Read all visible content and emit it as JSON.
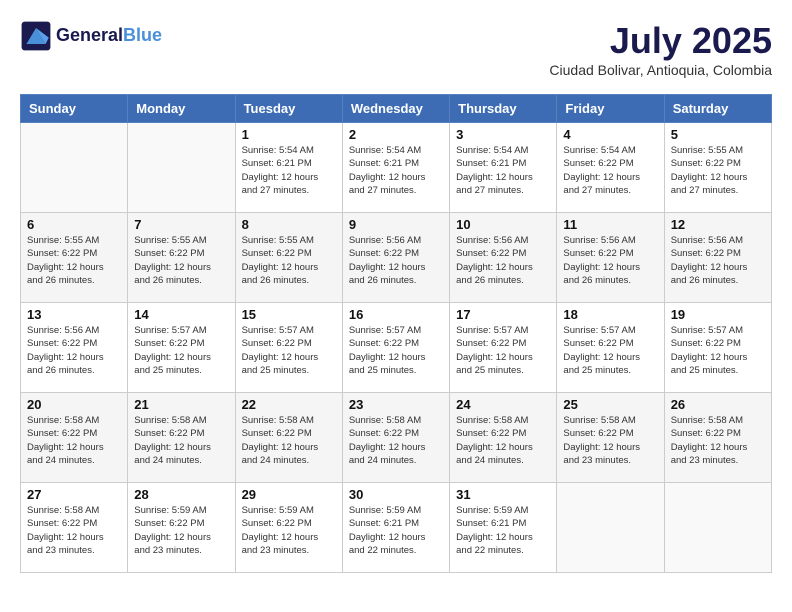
{
  "logo": {
    "line1": "General",
    "line2": "Blue"
  },
  "title": "July 2025",
  "location": "Ciudad Bolivar, Antioquia, Colombia",
  "weekdays": [
    "Sunday",
    "Monday",
    "Tuesday",
    "Wednesday",
    "Thursday",
    "Friday",
    "Saturday"
  ],
  "weeks": [
    [
      {
        "day": "",
        "info": ""
      },
      {
        "day": "",
        "info": ""
      },
      {
        "day": "1",
        "info": "Sunrise: 5:54 AM\nSunset: 6:21 PM\nDaylight: 12 hours and 27 minutes."
      },
      {
        "day": "2",
        "info": "Sunrise: 5:54 AM\nSunset: 6:21 PM\nDaylight: 12 hours and 27 minutes."
      },
      {
        "day": "3",
        "info": "Sunrise: 5:54 AM\nSunset: 6:21 PM\nDaylight: 12 hours and 27 minutes."
      },
      {
        "day": "4",
        "info": "Sunrise: 5:54 AM\nSunset: 6:22 PM\nDaylight: 12 hours and 27 minutes."
      },
      {
        "day": "5",
        "info": "Sunrise: 5:55 AM\nSunset: 6:22 PM\nDaylight: 12 hours and 27 minutes."
      }
    ],
    [
      {
        "day": "6",
        "info": "Sunrise: 5:55 AM\nSunset: 6:22 PM\nDaylight: 12 hours and 26 minutes."
      },
      {
        "day": "7",
        "info": "Sunrise: 5:55 AM\nSunset: 6:22 PM\nDaylight: 12 hours and 26 minutes."
      },
      {
        "day": "8",
        "info": "Sunrise: 5:55 AM\nSunset: 6:22 PM\nDaylight: 12 hours and 26 minutes."
      },
      {
        "day": "9",
        "info": "Sunrise: 5:56 AM\nSunset: 6:22 PM\nDaylight: 12 hours and 26 minutes."
      },
      {
        "day": "10",
        "info": "Sunrise: 5:56 AM\nSunset: 6:22 PM\nDaylight: 12 hours and 26 minutes."
      },
      {
        "day": "11",
        "info": "Sunrise: 5:56 AM\nSunset: 6:22 PM\nDaylight: 12 hours and 26 minutes."
      },
      {
        "day": "12",
        "info": "Sunrise: 5:56 AM\nSunset: 6:22 PM\nDaylight: 12 hours and 26 minutes."
      }
    ],
    [
      {
        "day": "13",
        "info": "Sunrise: 5:56 AM\nSunset: 6:22 PM\nDaylight: 12 hours and 26 minutes."
      },
      {
        "day": "14",
        "info": "Sunrise: 5:57 AM\nSunset: 6:22 PM\nDaylight: 12 hours and 25 minutes."
      },
      {
        "day": "15",
        "info": "Sunrise: 5:57 AM\nSunset: 6:22 PM\nDaylight: 12 hours and 25 minutes."
      },
      {
        "day": "16",
        "info": "Sunrise: 5:57 AM\nSunset: 6:22 PM\nDaylight: 12 hours and 25 minutes."
      },
      {
        "day": "17",
        "info": "Sunrise: 5:57 AM\nSunset: 6:22 PM\nDaylight: 12 hours and 25 minutes."
      },
      {
        "day": "18",
        "info": "Sunrise: 5:57 AM\nSunset: 6:22 PM\nDaylight: 12 hours and 25 minutes."
      },
      {
        "day": "19",
        "info": "Sunrise: 5:57 AM\nSunset: 6:22 PM\nDaylight: 12 hours and 25 minutes."
      }
    ],
    [
      {
        "day": "20",
        "info": "Sunrise: 5:58 AM\nSunset: 6:22 PM\nDaylight: 12 hours and 24 minutes."
      },
      {
        "day": "21",
        "info": "Sunrise: 5:58 AM\nSunset: 6:22 PM\nDaylight: 12 hours and 24 minutes."
      },
      {
        "day": "22",
        "info": "Sunrise: 5:58 AM\nSunset: 6:22 PM\nDaylight: 12 hours and 24 minutes."
      },
      {
        "day": "23",
        "info": "Sunrise: 5:58 AM\nSunset: 6:22 PM\nDaylight: 12 hours and 24 minutes."
      },
      {
        "day": "24",
        "info": "Sunrise: 5:58 AM\nSunset: 6:22 PM\nDaylight: 12 hours and 24 minutes."
      },
      {
        "day": "25",
        "info": "Sunrise: 5:58 AM\nSunset: 6:22 PM\nDaylight: 12 hours and 23 minutes."
      },
      {
        "day": "26",
        "info": "Sunrise: 5:58 AM\nSunset: 6:22 PM\nDaylight: 12 hours and 23 minutes."
      }
    ],
    [
      {
        "day": "27",
        "info": "Sunrise: 5:58 AM\nSunset: 6:22 PM\nDaylight: 12 hours and 23 minutes."
      },
      {
        "day": "28",
        "info": "Sunrise: 5:59 AM\nSunset: 6:22 PM\nDaylight: 12 hours and 23 minutes."
      },
      {
        "day": "29",
        "info": "Sunrise: 5:59 AM\nSunset: 6:22 PM\nDaylight: 12 hours and 23 minutes."
      },
      {
        "day": "30",
        "info": "Sunrise: 5:59 AM\nSunset: 6:21 PM\nDaylight: 12 hours and 22 minutes."
      },
      {
        "day": "31",
        "info": "Sunrise: 5:59 AM\nSunset: 6:21 PM\nDaylight: 12 hours and 22 minutes."
      },
      {
        "day": "",
        "info": ""
      },
      {
        "day": "",
        "info": ""
      }
    ]
  ]
}
